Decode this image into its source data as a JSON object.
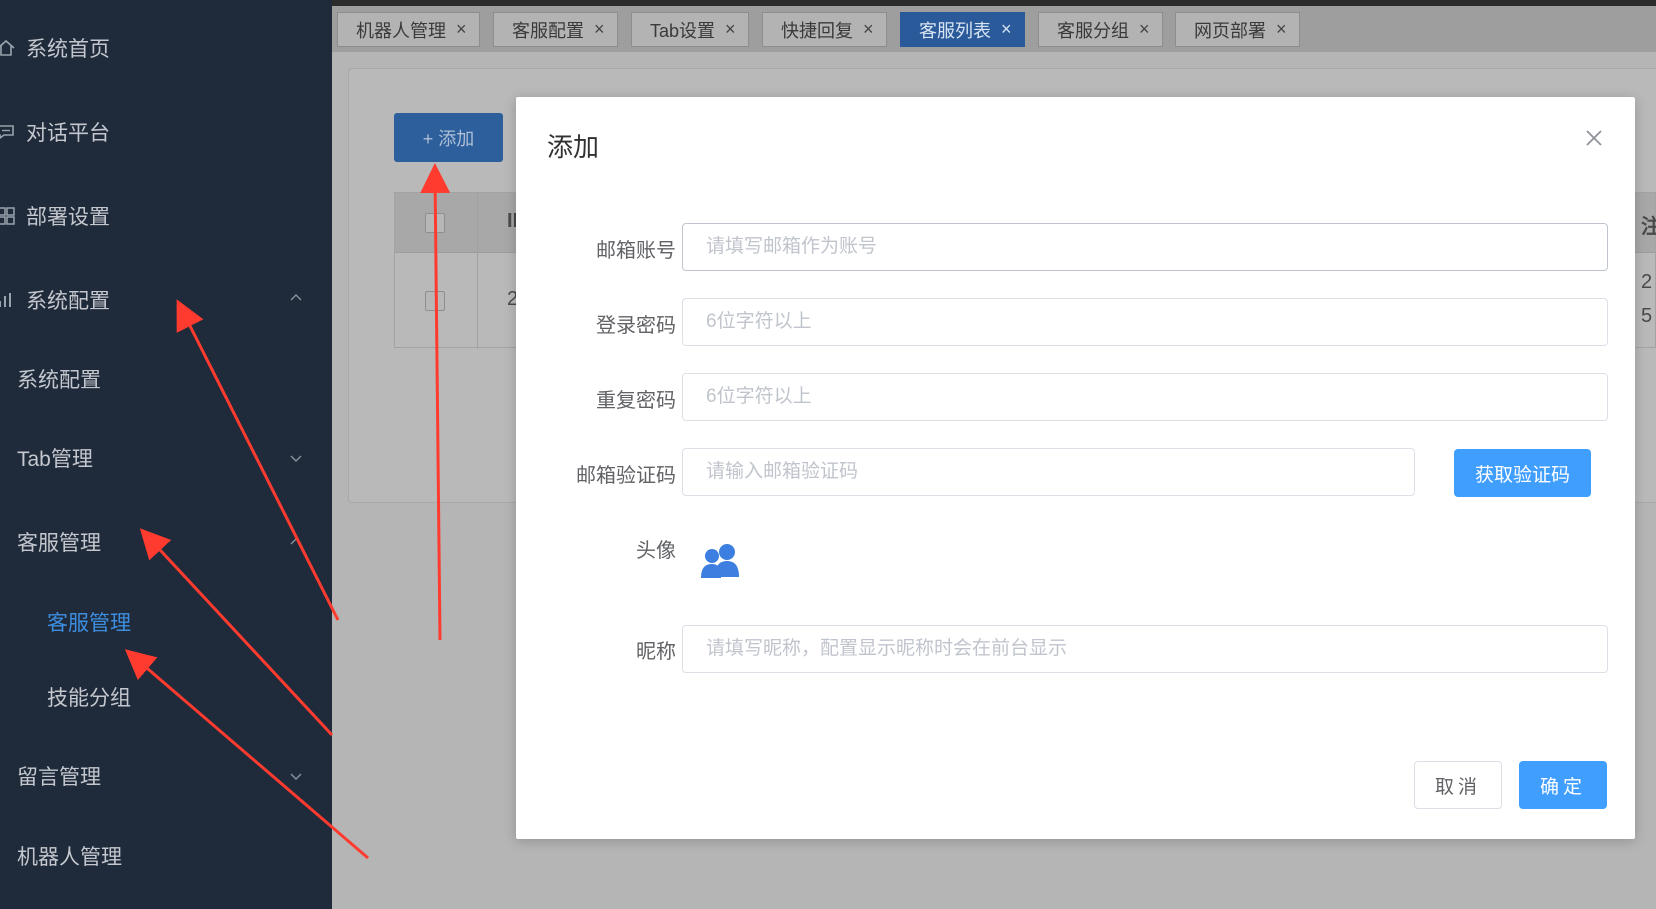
{
  "sidebar": {
    "items": [
      {
        "label": "系统首页",
        "icon": "home-icon"
      },
      {
        "label": "对话平台",
        "icon": "chat-icon"
      },
      {
        "label": "部署设置",
        "icon": "grid-icon"
      },
      {
        "label": "系统配置",
        "icon": "chart-icon"
      }
    ],
    "sub": [
      {
        "label": "系统配置"
      },
      {
        "label": "Tab管理"
      },
      {
        "label": "客服管理"
      },
      {
        "label": "客服管理"
      },
      {
        "label": "技能分组"
      },
      {
        "label": "留言管理"
      },
      {
        "label": "机器人管理"
      }
    ]
  },
  "tabs": [
    {
      "label": "机器人管理"
    },
    {
      "label": "客服配置"
    },
    {
      "label": "Tab设置"
    },
    {
      "label": "快捷回复"
    },
    {
      "label": "客服列表"
    },
    {
      "label": "客服分组"
    },
    {
      "label": "网页部署"
    }
  ],
  "page": {
    "add_label": "+ 添加",
    "table": {
      "head_partial": "II",
      "row_partial": "2",
      "right_col_head": "注",
      "right_col_row1": "2",
      "right_col_row2": "5"
    }
  },
  "modal": {
    "title": "添加",
    "fields": {
      "email": {
        "label": "邮箱账号",
        "placeholder": "请填写邮箱作为账号"
      },
      "password": {
        "label": "登录密码",
        "placeholder": "6位字符以上"
      },
      "repeat": {
        "label": "重复密码",
        "placeholder": "6位字符以上"
      },
      "code": {
        "label": "邮箱验证码",
        "placeholder": "请输入邮箱验证码",
        "button": "获取验证码"
      },
      "avatar": {
        "label": "头像",
        "icon": "users-icon"
      },
      "nickname": {
        "label": "昵称",
        "placeholder": "请填写昵称，配置显示昵称时会在前台显示"
      }
    },
    "cancel": "取消",
    "confirm": "确定"
  },
  "colors": {
    "primary": "#409eff",
    "sidebar": "#1f2a3a",
    "active_tab": "#2a5a9a",
    "annotation": "#ff3b30"
  }
}
